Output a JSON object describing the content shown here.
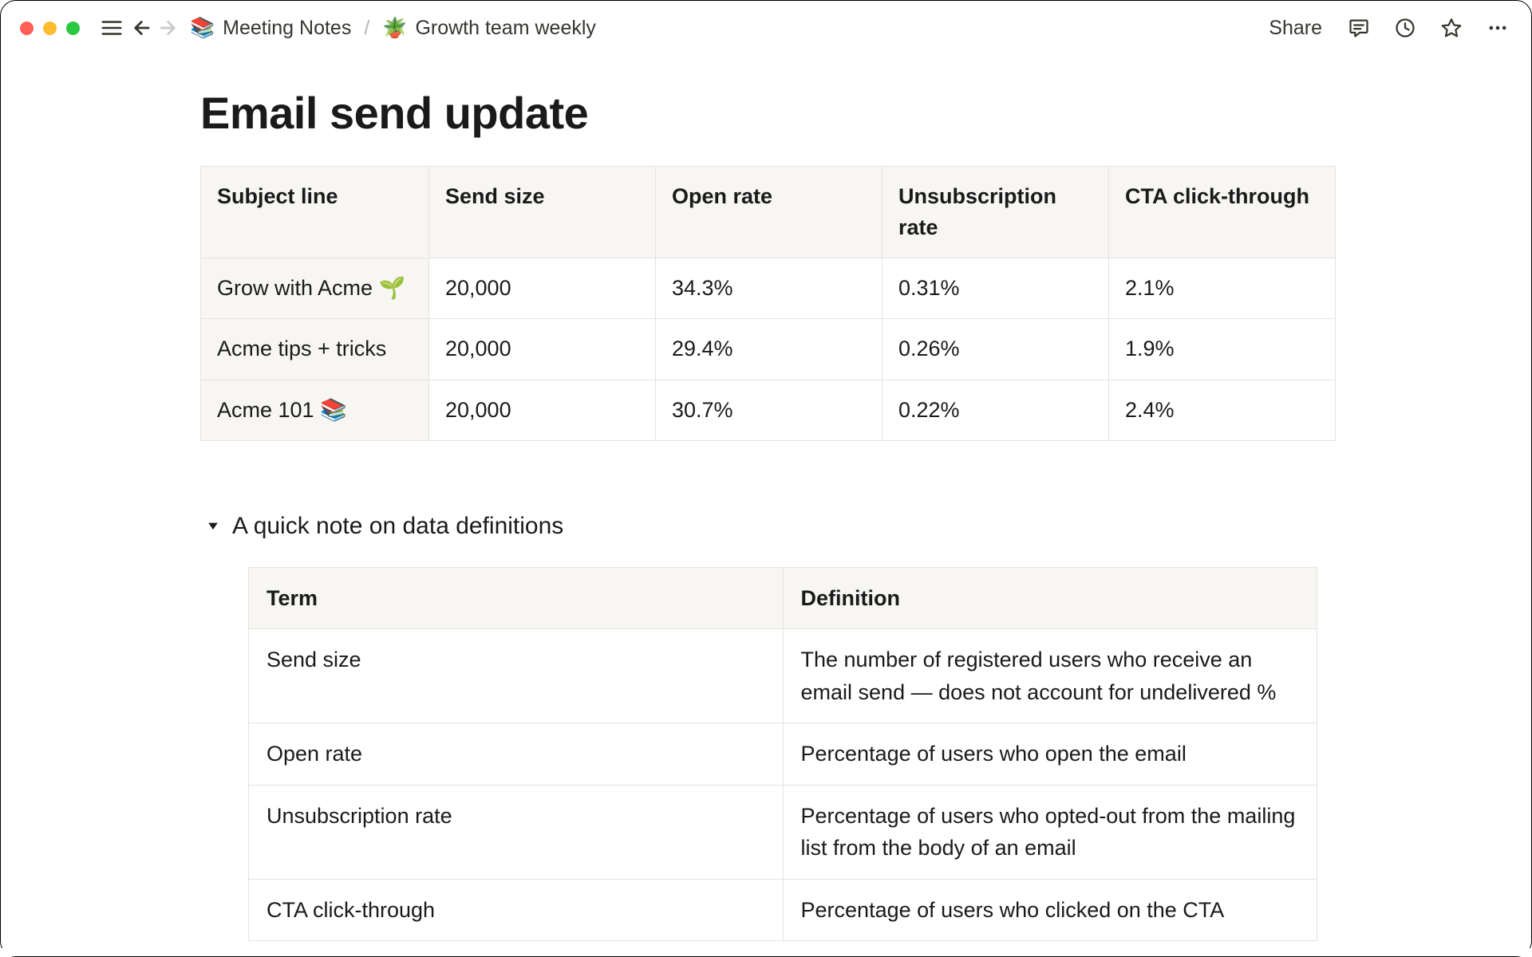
{
  "breadcrumb": {
    "parent_icon": "📚",
    "parent_label": "Meeting Notes",
    "separator": "/",
    "current_icon": "🪴",
    "current_label": "Growth team weekly"
  },
  "topbar": {
    "share_label": "Share"
  },
  "page": {
    "title": "Email send update"
  },
  "metrics_table": {
    "headers": [
      "Subject line",
      "Send size",
      "Open rate",
      "Unsubscription rate",
      "CTA click-through"
    ],
    "rows": [
      {
        "subject": "Grow with Acme 🌱",
        "send_size": "20,000",
        "open_rate": "34.3%",
        "unsub_rate": "0.31%",
        "cta": "2.1%"
      },
      {
        "subject": "Acme tips + tricks",
        "send_size": "20,000",
        "open_rate": "29.4%",
        "unsub_rate": "0.26%",
        "cta": "1.9%"
      },
      {
        "subject": "Acme 101 📚",
        "send_size": "20,000",
        "open_rate": "30.7%",
        "unsub_rate": "0.22%",
        "cta": "2.4%"
      }
    ]
  },
  "toggle": {
    "title": "A quick note on data definitions"
  },
  "definitions_table": {
    "headers": [
      "Term",
      "Definition"
    ],
    "rows": [
      {
        "term": "Send size",
        "definition": "The number of registered users who receive an email send — does not account for undelivered %"
      },
      {
        "term": "Open rate",
        "definition": "Percentage of users who open the email"
      },
      {
        "term": "Unsubscription rate",
        "definition": "Percentage of users who opted-out from the mailing list from the body of an email"
      },
      {
        "term": "CTA click-through",
        "definition": "Percentage of users who clicked on the CTA"
      }
    ]
  },
  "chart_data": {
    "type": "table",
    "title": "Email send update",
    "columns": [
      "Subject line",
      "Send size",
      "Open rate",
      "Unsubscription rate",
      "CTA click-through"
    ],
    "rows": [
      [
        "Grow with Acme 🌱",
        20000,
        0.343,
        0.0031,
        0.021
      ],
      [
        "Acme tips + tricks",
        20000,
        0.294,
        0.0026,
        0.019
      ],
      [
        "Acme 101 📚",
        20000,
        0.307,
        0.0022,
        0.024
      ]
    ]
  }
}
